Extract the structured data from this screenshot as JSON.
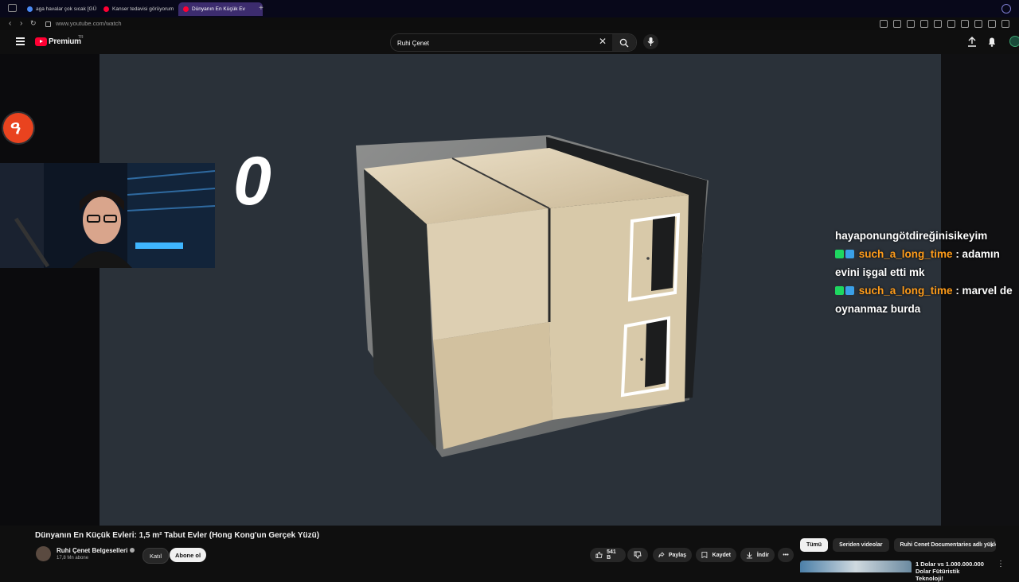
{
  "browser": {
    "tabs": [
      {
        "label": "aga havalar çok sıcak [GÜ",
        "active": false
      },
      {
        "label": "Kanser tedavisi görüyorum",
        "active": false
      },
      {
        "label": "Dünyanın En Küçük Ev",
        "active": true
      }
    ],
    "new_tab": "+",
    "url": "www.youtube.com/watch"
  },
  "youtube": {
    "logo_text": "Premium",
    "logo_sup": "TR",
    "search_value": "Ruhi Çenet",
    "brand_color": "#ff0033"
  },
  "overlay": {
    "digit": "0",
    "streamer_logo": "ዓ"
  },
  "chat": [
    {
      "user": "",
      "text": "hayaponungötdireğinisikeyim",
      "badges": []
    },
    {
      "user": "such_a_long_time",
      "text": " : adamın evini işgal etti mk",
      "badges": [
        "kick-icon",
        "pickaxe-icon"
      ]
    },
    {
      "user": "such_a_long_time",
      "text": " : marvel de oynanmaz burda",
      "badges": [
        "kick-icon",
        "pickaxe-icon"
      ]
    }
  ],
  "video": {
    "title": "Dünyanın En Küçük Evleri: 1,5 m² Tabut Evler (Hong Kong'un Gerçek Yüzü)",
    "channel": "Ruhi Çenet Belgeselleri",
    "subscribers": "17,8 Mn abone",
    "join_label": "Katıl",
    "subscribe_label": "Abone ol",
    "like_count": "541 B",
    "share_label": "Paylaş",
    "save_label": "Kaydet",
    "download_label": "İndir",
    "more_label": "•••"
  },
  "recommendations": {
    "chips": [
      {
        "label": "Tümü",
        "active": true
      },
      {
        "label": "Seriden videolar",
        "active": false
      },
      {
        "label": "Ruhi Cenet Documentaries adlı yükle",
        "active": false
      }
    ],
    "first_title": "1 Dolar vs 1.000.000.000 Dolar Fütüristik Teknoloji!"
  }
}
